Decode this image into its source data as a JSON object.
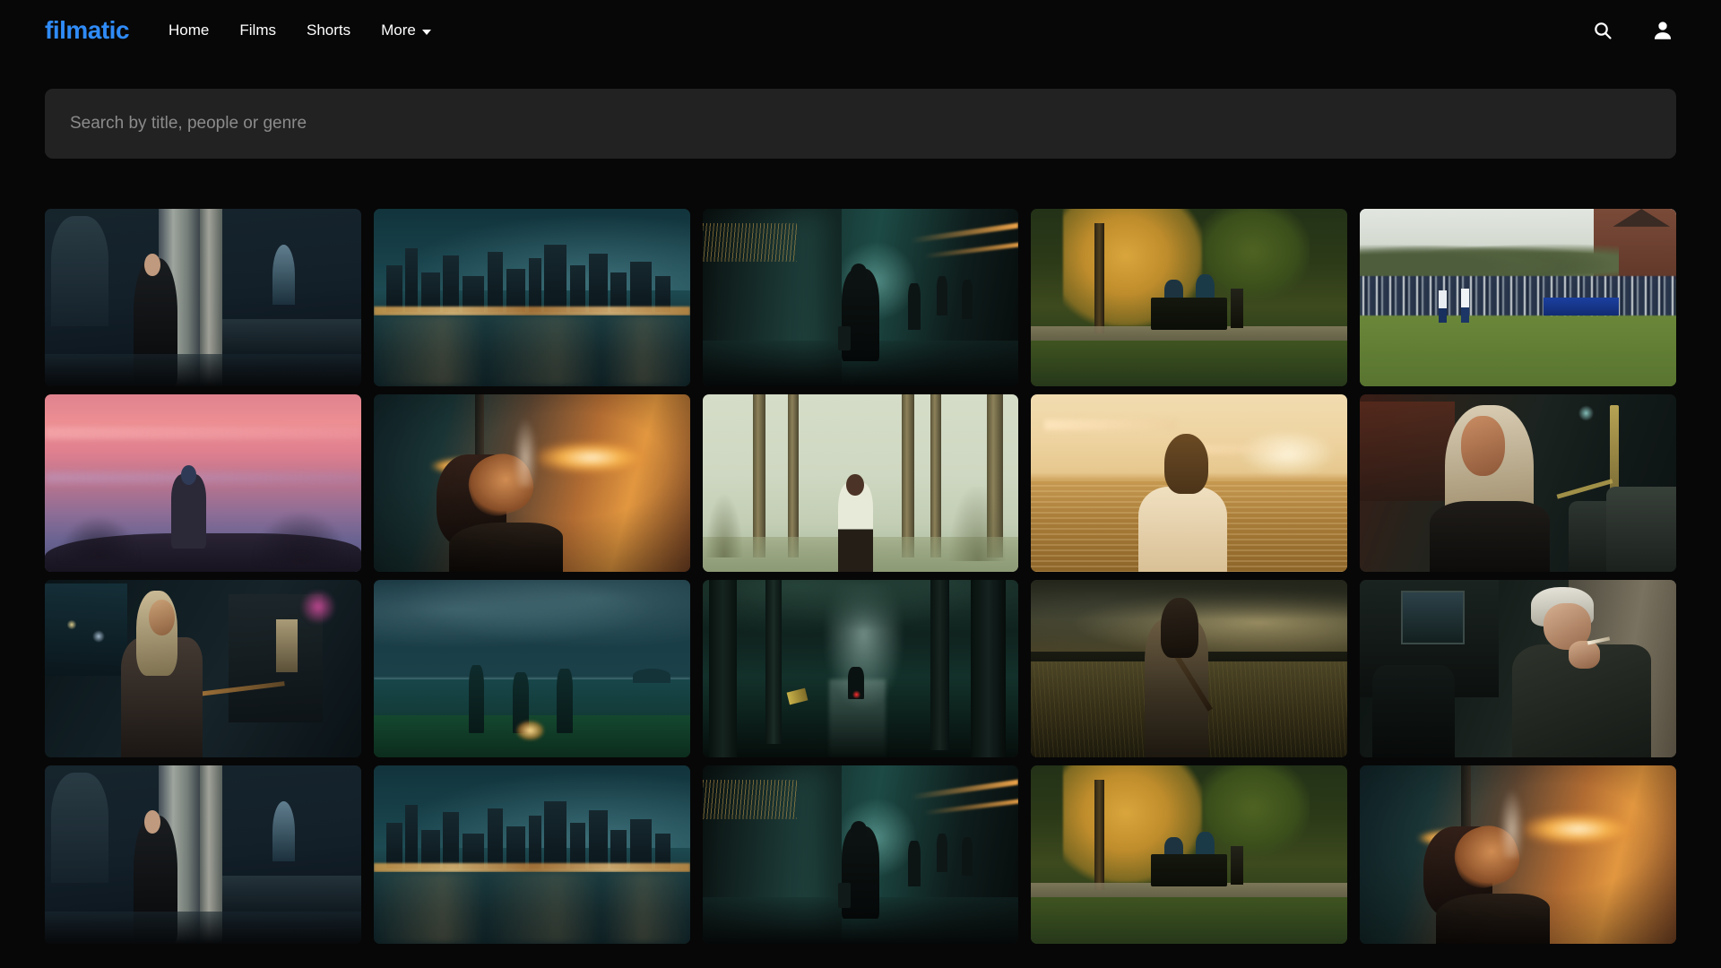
{
  "brand": {
    "name": "filmatic",
    "color": "#2f8bf7"
  },
  "nav": {
    "links": [
      {
        "label": "Home",
        "name": "nav-link-home"
      },
      {
        "label": "Films",
        "name": "nav-link-films"
      },
      {
        "label": "Shorts",
        "name": "nav-link-shorts"
      },
      {
        "label": "More",
        "name": "nav-link-more",
        "has_caret": true
      }
    ],
    "icons": [
      {
        "label": "search-icon"
      },
      {
        "label": "account-icon"
      }
    ]
  },
  "search": {
    "placeholder": "Search by title, people or genre",
    "value": ""
  },
  "gallery": {
    "items": [
      {
        "id": 1,
        "alt": "Woman standing in a dark cathedral",
        "style": "s-cathedral"
      },
      {
        "id": 2,
        "alt": "City skyline at night across water",
        "style": "s-city"
      },
      {
        "id": 3,
        "alt": "Man walking through a lit tunnel",
        "style": "s-tunnel"
      },
      {
        "id": 4,
        "alt": "Two people on a park bench in autumn",
        "style": "s-park"
      },
      {
        "id": 5,
        "alt": "School crowd cheering at a sports field",
        "style": "s-field"
      },
      {
        "id": 6,
        "alt": "Hiker silhouetted against a pink sunset",
        "style": "s-hiker"
      },
      {
        "id": 7,
        "alt": "Woman exhaling smoke under warm lights",
        "style": "s-smoke"
      },
      {
        "id": 8,
        "alt": "Man in white vest among palm trunks",
        "style": "s-palm"
      },
      {
        "id": 9,
        "alt": "Man facing a golden sunset ocean",
        "style": "s-ocean"
      },
      {
        "id": 10,
        "alt": "Blonde woman riding a bus at night",
        "style": "s-bus"
      },
      {
        "id": 11,
        "alt": "Woman on a balcony at night",
        "style": "s-balcony"
      },
      {
        "id": 12,
        "alt": "Three figures around a beach campfire",
        "style": "s-fire"
      },
      {
        "id": 13,
        "alt": "Cyclist on a misty forest path",
        "style": "s-forest"
      },
      {
        "id": 14,
        "alt": "Woman with a rifle in a stormy field",
        "style": "s-rifle"
      },
      {
        "id": 15,
        "alt": "Man smoking in a stone alley",
        "style": "s-alley"
      },
      {
        "id": 16,
        "alt": "Woman standing in a dark cathedral",
        "style": "s-cathedral"
      },
      {
        "id": 17,
        "alt": "City skyline at night across water",
        "style": "s-city"
      },
      {
        "id": 18,
        "alt": "Man walking through a lit tunnel",
        "style": "s-tunnel"
      },
      {
        "id": 19,
        "alt": "Two people on a park bench in autumn",
        "style": "s-park"
      },
      {
        "id": 20,
        "alt": "Woman exhaling smoke under warm lights",
        "style": "s-smoke"
      }
    ]
  },
  "theme": {
    "background": "#070707",
    "search_background": "#222222",
    "text": "#ffffff",
    "placeholder": "#8b8b8b"
  }
}
